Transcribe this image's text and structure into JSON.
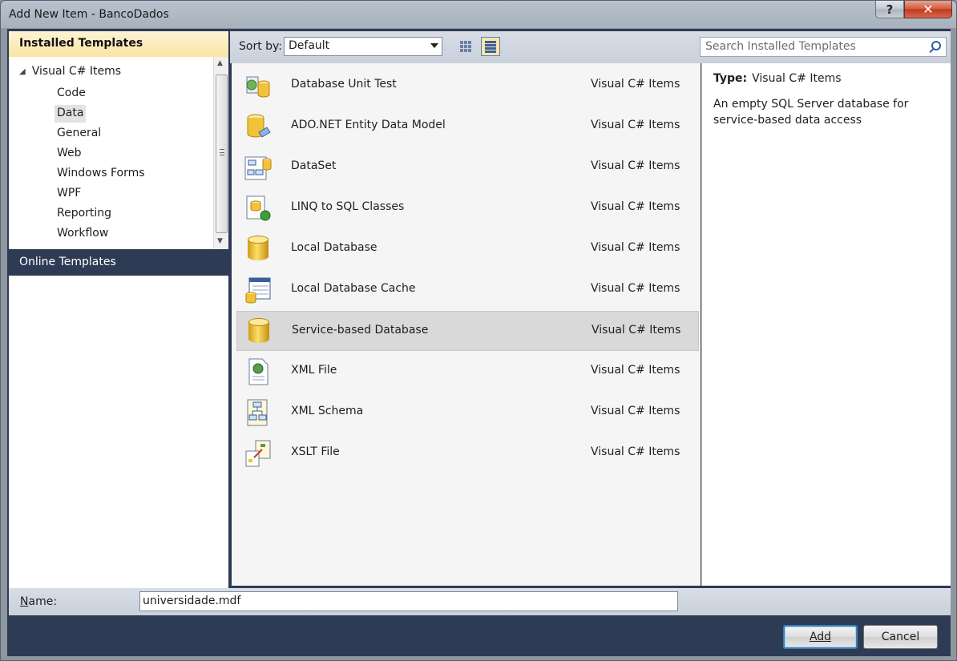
{
  "window": {
    "title": "Add New Item - BancoDados",
    "help_glyph": "?",
    "close_glyph": "✕"
  },
  "sidebar": {
    "installed_header": "Installed Templates",
    "root": {
      "label": "Visual C# Items",
      "expander": "◢"
    },
    "items": [
      "Code",
      "Data",
      "General",
      "Web",
      "Windows Forms",
      "WPF",
      "Reporting",
      "Workflow"
    ],
    "selected": "Data",
    "online_header": "Online Templates"
  },
  "toolbar": {
    "sort_label": "Sort by:",
    "sort_value": "Default",
    "search_placeholder": "Search Installed Templates"
  },
  "templates": [
    {
      "name": "Database Unit Test",
      "category": "Visual C# Items",
      "icon": "database-unit-test-icon"
    },
    {
      "name": "ADO.NET Entity Data Model",
      "category": "Visual C# Items",
      "icon": "entity-model-icon"
    },
    {
      "name": "DataSet",
      "category": "Visual C# Items",
      "icon": "dataset-icon"
    },
    {
      "name": "LINQ to SQL Classes",
      "category": "Visual C# Items",
      "icon": "linq-icon"
    },
    {
      "name": "Local Database",
      "category": "Visual C# Items",
      "icon": "database-icon"
    },
    {
      "name": "Local Database Cache",
      "category": "Visual C# Items",
      "icon": "database-cache-icon"
    },
    {
      "name": "Service-based Database",
      "category": "Visual C# Items",
      "icon": "database-icon"
    },
    {
      "name": "XML File",
      "category": "Visual C# Items",
      "icon": "xml-file-icon"
    },
    {
      "name": "XML Schema",
      "category": "Visual C# Items",
      "icon": "xml-schema-icon"
    },
    {
      "name": "XSLT File",
      "category": "Visual C# Items",
      "icon": "xslt-file-icon"
    }
  ],
  "selected_template": "Service-based Database",
  "details": {
    "type_label": "Type:",
    "type_value": "Visual C# Items",
    "description": "An empty SQL Server database for service-based data access"
  },
  "name_field": {
    "label": "Name:",
    "value": "universidade.mdf"
  },
  "buttons": {
    "add": "Add",
    "cancel": "Cancel"
  }
}
